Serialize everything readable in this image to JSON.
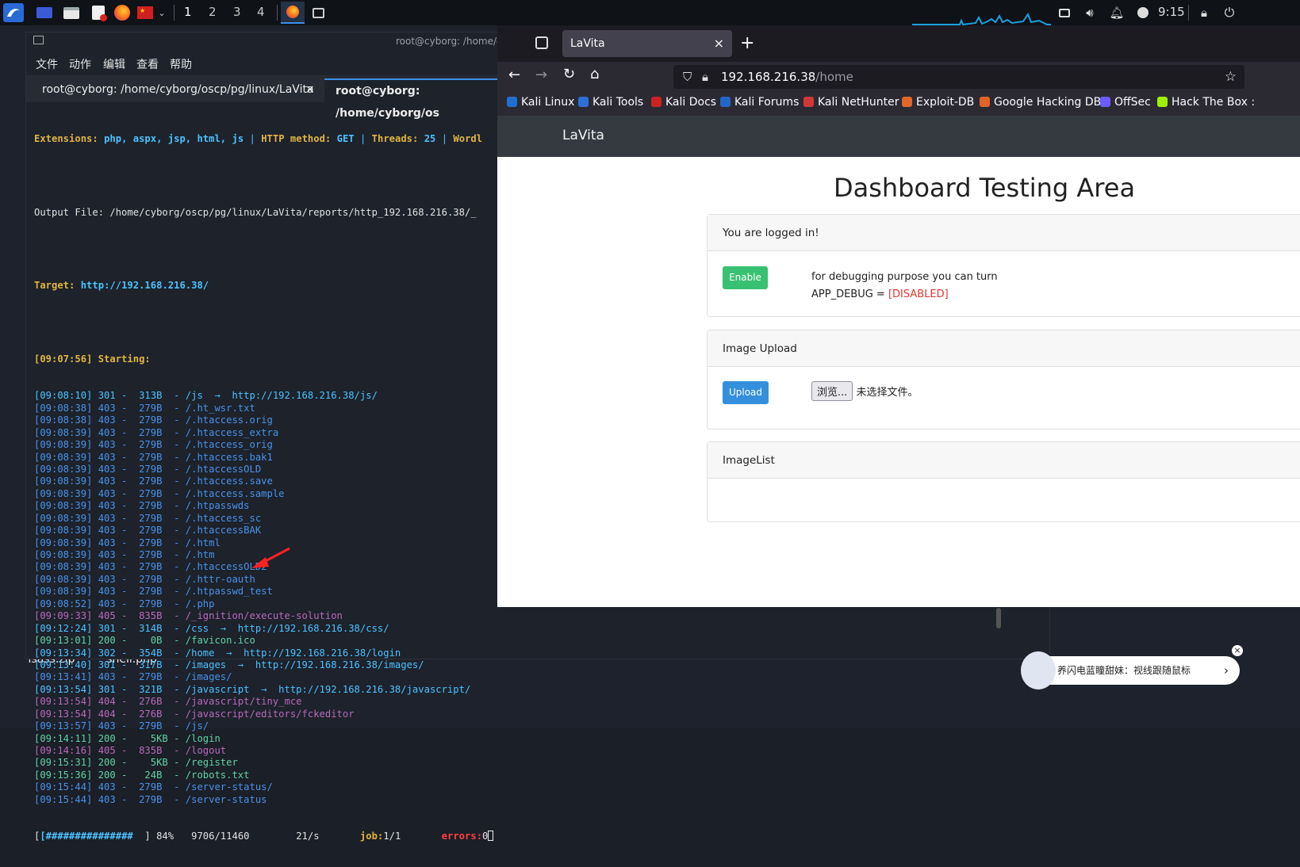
{
  "taskbar": {
    "workspaces": [
      "1",
      "2",
      "3",
      "4"
    ],
    "clock": "9:15"
  },
  "desktop": {
    "icons": [
      {
        "label": "lsass.zip"
      },
      {
        "label": "shell.php"
      }
    ]
  },
  "terminal": {
    "title": "root@cyborg: /home/cyl",
    "menu": [
      "文件",
      "动作",
      "编辑",
      "查看",
      "帮助"
    ],
    "tabs": [
      {
        "label": "root@cyborg: /home/cyborg/oscp/pg/linux/LaVita",
        "close": "×"
      },
      {
        "label": "root@cyborg: /home/cyborg/os"
      }
    ],
    "header_lines": {
      "ext_label": "Extensions:",
      "ext_value": "php, aspx, jsp, html, js",
      "sep": "|",
      "method_label": "HTTP method:",
      "method_value": "GET",
      "threads_label": "Threads:",
      "threads_value": "25",
      "wordl": "Wordl",
      "output": "Output File: /home/cyborg/oscp/pg/linux/LaVita/reports/http_192.168.216.38/_",
      "target_label": "Target:",
      "target_value": "http://192.168.216.38/",
      "starting": "[09:07:56] Starting:"
    },
    "scan_lines": [
      {
        "t": "[09:08:10] 301 -  313B  - /js  →  http://192.168.216.38/js/",
        "c": "cyan"
      },
      {
        "t": "[09:08:38] 403 -  279B  - /.ht_wsr.txt",
        "c": "blue"
      },
      {
        "t": "[09:08:38] 403 -  279B  - /.htaccess.orig",
        "c": "blue"
      },
      {
        "t": "[09:08:39] 403 -  279B  - /.htaccess_extra",
        "c": "blue"
      },
      {
        "t": "[09:08:39] 403 -  279B  - /.htaccess_orig",
        "c": "blue"
      },
      {
        "t": "[09:08:39] 403 -  279B  - /.htaccess.bak1",
        "c": "blue"
      },
      {
        "t": "[09:08:39] 403 -  279B  - /.htaccessOLD",
        "c": "blue"
      },
      {
        "t": "[09:08:39] 403 -  279B  - /.htaccess.save",
        "c": "blue"
      },
      {
        "t": "[09:08:39] 403 -  279B  - /.htaccess.sample",
        "c": "blue"
      },
      {
        "t": "[09:08:39] 403 -  279B  - /.htpasswds",
        "c": "blue"
      },
      {
        "t": "[09:08:39] 403 -  279B  - /.htaccess_sc",
        "c": "blue"
      },
      {
        "t": "[09:08:39] 403 -  279B  - /.htaccessBAK",
        "c": "blue"
      },
      {
        "t": "[09:08:39] 403 -  279B  - /.html",
        "c": "blue"
      },
      {
        "t": "[09:08:39] 403 -  279B  - /.htm",
        "c": "blue"
      },
      {
        "t": "[09:08:39] 403 -  279B  - /.htaccessOLD2",
        "c": "blue"
      },
      {
        "t": "[09:08:39] 403 -  279B  - /.httr-oauth",
        "c": "blue"
      },
      {
        "t": "[09:08:39] 403 -  279B  - /.htpasswd_test",
        "c": "blue"
      },
      {
        "t": "[09:08:52] 403 -  279B  - /.php",
        "c": "blue"
      },
      {
        "t": "[09:09:33] 405 -  835B  - /_ignition/execute-solution",
        "c": "purple"
      },
      {
        "t": "[09:12:24] 301 -  314B  - /css  →  http://192.168.216.38/css/",
        "c": "cyan"
      },
      {
        "t": "[09:13:01] 200 -    0B  - /favicon.ico",
        "c": "green"
      },
      {
        "t": "[09:13:34] 302 -  354B  - /home  →  http://192.168.216.38/login",
        "c": "cyan"
      },
      {
        "t": "[09:13:40] 301 -  317B  - /images  →  http://192.168.216.38/images/",
        "c": "cyan"
      },
      {
        "t": "[09:13:41] 403 -  279B  - /images/",
        "c": "blue"
      },
      {
        "t": "[09:13:54] 301 -  321B  - /javascript  →  http://192.168.216.38/javascript/",
        "c": "cyan"
      },
      {
        "t": "[09:13:54] 404 -  276B  - /javascript/tiny_mce",
        "c": "purple"
      },
      {
        "t": "[09:13:54] 404 -  276B  - /javascript/editors/fckeditor",
        "c": "purple"
      },
      {
        "t": "[09:13:57] 403 -  279B  - /js/",
        "c": "blue"
      },
      {
        "t": "[09:14:11] 200 -    5KB - /login",
        "c": "green"
      },
      {
        "t": "[09:14:16] 405 -  835B  - /logout",
        "c": "purple"
      },
      {
        "t": "[09:15:31] 200 -    5KB - /register",
        "c": "green"
      },
      {
        "t": "[09:15:36] 200 -   24B  - /robots.txt",
        "c": "green"
      },
      {
        "t": "[09:15:44] 403 -  279B  - /server-status/",
        "c": "blue"
      },
      {
        "t": "[09:15:44] 403 -  279B  - /server-status",
        "c": "blue"
      }
    ],
    "progress": {
      "bar": "[###############",
      "rest": "  ] 84%   9706/11460        21/s       ",
      "job_label": "job:",
      "job_value": "1/1",
      "errors_label": "errors:",
      "errors_value": "0"
    }
  },
  "browser": {
    "tab_title": "LaVita",
    "tab_close": "×",
    "new_tab": "+",
    "url_host": "192.168.216.38",
    "url_path": "/home",
    "bookmarks": [
      {
        "label": "Kali Linux",
        "color": "#1f6fd0"
      },
      {
        "label": "Kali Tools",
        "color": "#2f6fd8"
      },
      {
        "label": "Kali Docs",
        "color": "#cc2222"
      },
      {
        "label": "Kali Forums",
        "color": "#2466c8"
      },
      {
        "label": "Kali NetHunter",
        "color": "#d03838"
      },
      {
        "label": "Exploit-DB",
        "color": "#e0662a"
      },
      {
        "label": "Google Hacking DB",
        "color": "#e06428"
      },
      {
        "label": "OffSec",
        "color": "#6a5cff"
      },
      {
        "label": "Hack The Box :",
        "color": "#9fef00"
      }
    ],
    "page": {
      "brand": "LaVita",
      "heading": "Dashboard Testing Area",
      "card1_header": "You are logged in!",
      "enable_btn": "Enable",
      "debug_text": "for debugging purpose you can turn",
      "app_debug_label": "APP_DEBUG = ",
      "app_debug_value": "[DISABLED]",
      "card2_header": "Image Upload",
      "upload_btn": "Upload",
      "browse_btn": "浏览...",
      "no_file": "未选择文件。",
      "card3_header": "ImageList"
    }
  },
  "popup": {
    "text": "养闪电蓝瞳甜妹：视线跟随鼠标",
    "arrow": "›",
    "close": "×"
  }
}
